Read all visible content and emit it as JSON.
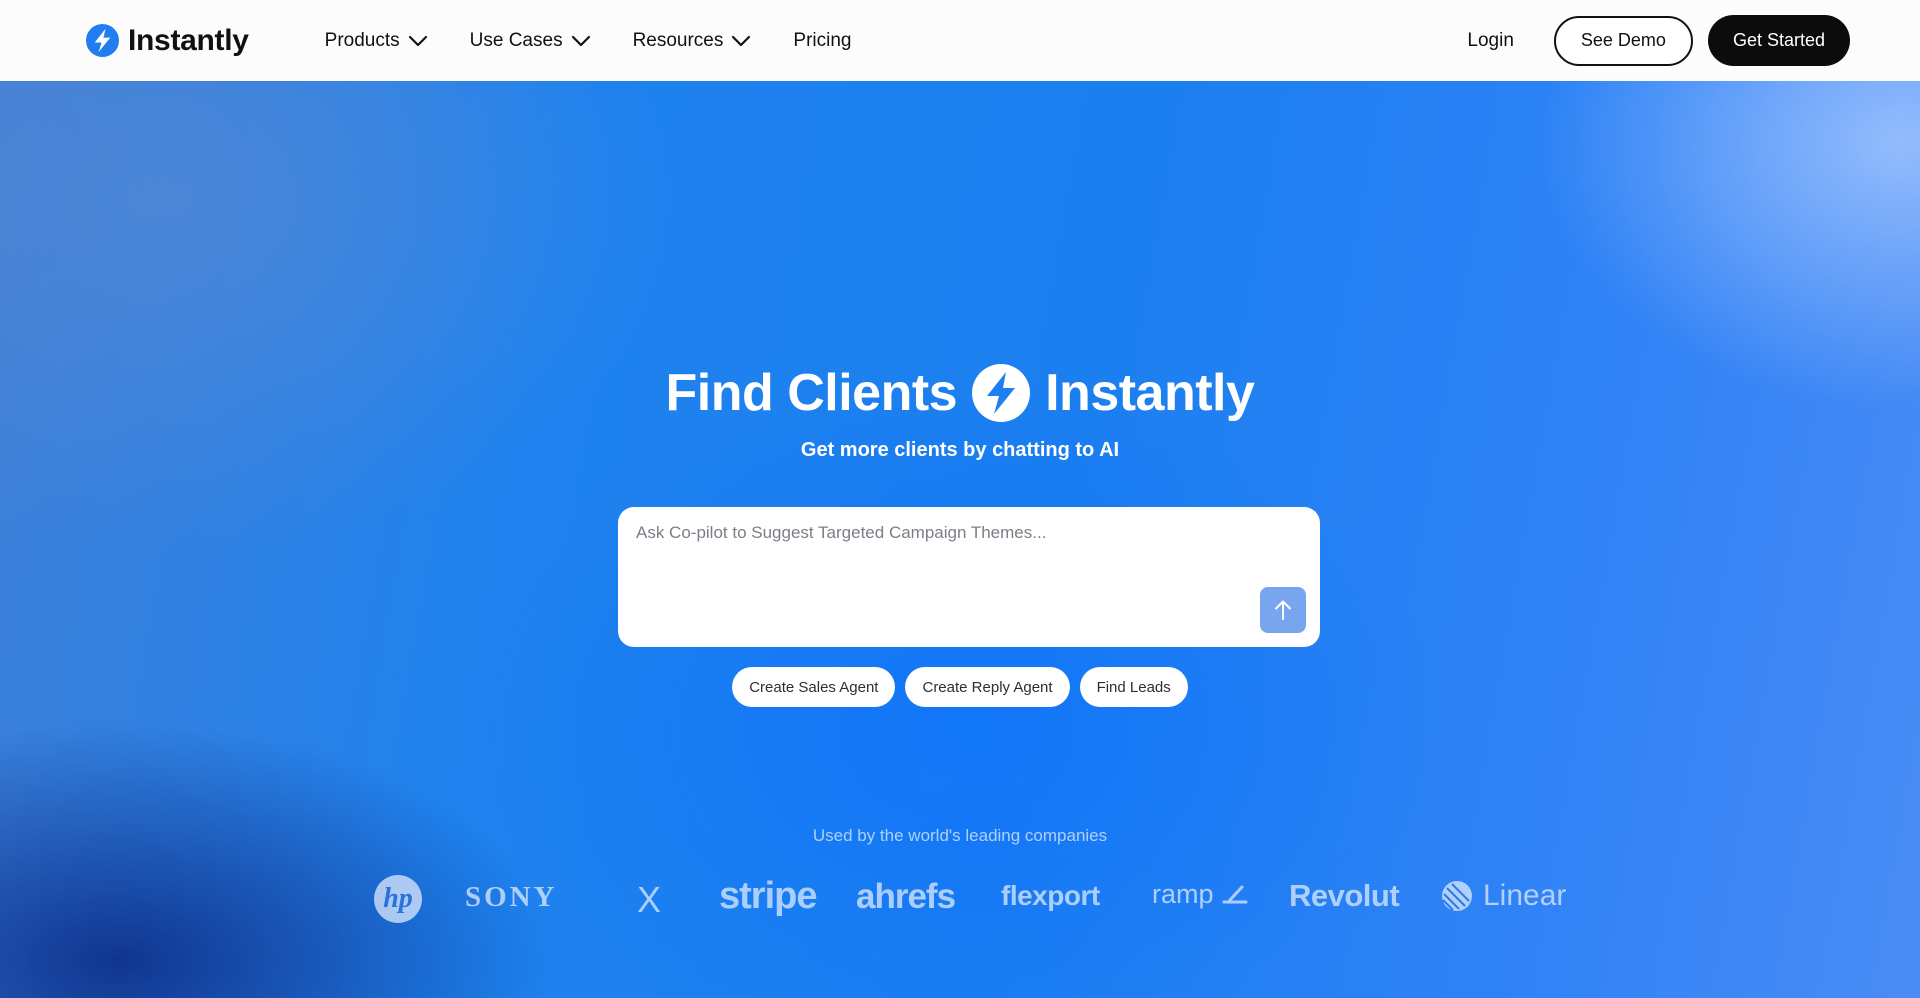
{
  "nav": {
    "brand": "Instantly",
    "menu": [
      {
        "label": "Products",
        "has_dropdown": true
      },
      {
        "label": "Use Cases",
        "has_dropdown": true
      },
      {
        "label": "Resources",
        "has_dropdown": true
      },
      {
        "label": "Pricing",
        "has_dropdown": false
      }
    ],
    "login": "Login",
    "see_demo": "See Demo",
    "get_started": "Get Started"
  },
  "hero": {
    "title_left": "Find Clients",
    "title_right": "Instantly",
    "subtitle": "Get more clients by chatting to AI",
    "prompt_placeholder": "Ask Co-pilot to Suggest Targeted Campaign Themes...",
    "chips": [
      "Create Sales Agent",
      "Create Reply Agent",
      "Find Leads"
    ],
    "used_by": "Used by the world's leading companies",
    "logos": [
      "hp",
      "SONY",
      "X",
      "stripe",
      "ahrefs",
      "flexport",
      "ramp",
      "Revolut",
      "Linear"
    ]
  },
  "colors": {
    "brand_blue": "#1f7ff0",
    "nav_bg": "#fcfcfc",
    "dark_button": "#0c0c0c",
    "send_button": "#78a6ee"
  },
  "icons": {
    "brand": "lightning-bolt-icon",
    "dropdown": "chevron-down-icon",
    "send": "arrow-up-icon"
  }
}
